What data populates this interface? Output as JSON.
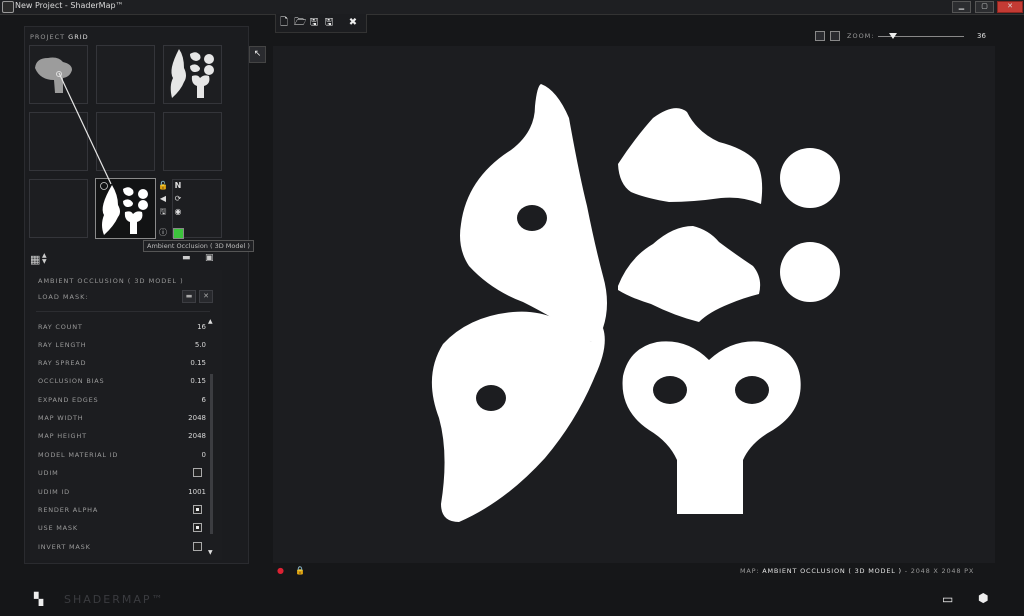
{
  "window": {
    "title": "New Project - ShaderMap™",
    "buttons": {
      "minimize": "▁",
      "maximize": "▢",
      "close": "✕"
    }
  },
  "toolbar": {
    "icons": [
      "new-document-icon",
      "open-folder-icon",
      "save-icon",
      "save-as-icon",
      "tools-icon"
    ],
    "glyphs": {
      "new": "🗋",
      "open": "🗁",
      "save": "🖫",
      "save_as": "🖫",
      "tools": "✖"
    }
  },
  "project_grid": {
    "label_prefix": "PROJECT",
    "label_strong": "GRID",
    "tooltip": "Ambient Occlusion ( 3D Model )",
    "node_glyphs": {
      "lock": "🔓",
      "back": "◀",
      "save": "🖫",
      "n": "N",
      "refresh": "⟳",
      "view": "◉",
      "info": "ⓘ"
    }
  },
  "properties": {
    "title": "AMBIENT OCCLUSION ( 3D MODEL )",
    "load_mask_label": "LOAD MASK:",
    "rows": [
      {
        "label": "RAY COUNT",
        "value": "16"
      },
      {
        "label": "RAY LENGTH",
        "value": "5.0"
      },
      {
        "label": "RAY SPREAD",
        "value": "0.15"
      },
      {
        "label": "OCCLUSION BIAS",
        "value": "0.15"
      },
      {
        "label": "EXPAND EDGES",
        "value": "6"
      },
      {
        "label": "MAP WIDTH",
        "value": "2048"
      },
      {
        "label": "MAP HEIGHT",
        "value": "2048"
      },
      {
        "label": "MODEL MATERIAL ID",
        "value": "0"
      },
      {
        "label": "UDIM",
        "checkbox": false
      },
      {
        "label": "UDIM ID",
        "value": "1001"
      },
      {
        "label": "RENDER ALPHA",
        "checkbox": true
      },
      {
        "label": "USE MASK",
        "checkbox": true
      },
      {
        "label": "INVERT MASK",
        "checkbox": false
      }
    ]
  },
  "zoom": {
    "label": "ZOOM:",
    "value": "36"
  },
  "status": {
    "prefix": "MAP:",
    "map_name": "AMBIENT OCCLUSION ( 3D MODEL )",
    "size": "-  2048 X 2048 PX"
  },
  "brand": "SHADERMAP™",
  "colors": {
    "background": "#161719",
    "panel": "#1c1d20",
    "accent_green": "#3cc43c",
    "map_white": "#ffffff"
  }
}
